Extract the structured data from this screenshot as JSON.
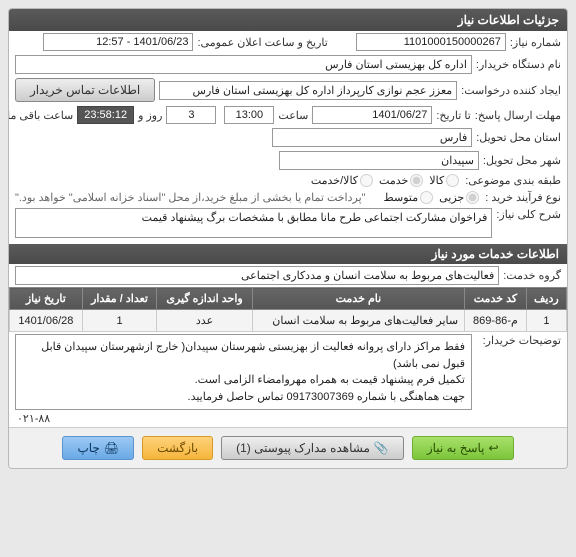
{
  "panel_title": "جزئیات اطلاعات نیاز",
  "fields": {
    "need_no_label": "شماره نیاز:",
    "need_no": "1101000150000267",
    "announce_dt_label": "تاریخ و ساعت اعلان عمومی:",
    "announce_dt": "1401/06/23 - 12:57",
    "buyer_label": "نام دستگاه خریدار:",
    "buyer": "اداره کل بهزیستی استان فارس",
    "creator_label": "ایجاد کننده درخواست:",
    "creator": "معزز عجم نوازی کارپرداز اداره کل بهزیستی استان فارس",
    "contact_btn": "اطلاعات تماس خریدار",
    "deadline_label1": "مهلت ارسال پاسخ:",
    "deadline_label2": "تا تاریخ:",
    "deadline_date": "1401/06/27",
    "saat": "ساعت",
    "deadline_time": "13:00",
    "rooz_va": "روز و",
    "remain_days": "3",
    "remain_time": "23:58:12",
    "remain_suffix": "ساعت باقی مانده",
    "province_label": "استان محل تحویل:",
    "province": "فارس",
    "city_label": "شهر محل تحویل:",
    "city": "سپیدان",
    "class_label": "طبقه بندی موضوعی:",
    "class_opts": {
      "kala": "کالا",
      "khadmat": "خدمت",
      "both": "کالا/خدمت"
    },
    "buytype_label": "نوع فرآیند خرید :",
    "buytype_opts": {
      "jozi": "جزیی",
      "motevaset": "متوسط"
    },
    "buytype_note": "\"پرداخت تمام یا بخشی از مبلغ خرید،از محل \"اسناد خزانه اسلامی\" خواهد بود.\"",
    "general_desc_label": "شرح کلی نیاز:",
    "general_desc": "فراخوان مشارکت اجتماعی طرح مانا مطابق با مشخصات برگ پیشنهاد قیمت",
    "services_title": "اطلاعات خدمات مورد نیاز",
    "group_label": "گروه خدمت:",
    "group": "فعالیت‌های مربوط به سلامت انسان و مددکاری اجتماعی",
    "buyer_notes_label": "توضیحات خریدار:",
    "buyer_notes": [
      "فقط مراکز دارای پروانه فعالیت از بهزیستی شهرستان سپیدان( خارج ازشهرستان  سپیدان  قابل قبول نمی باشد)",
      "تکمیل فرم پیشنهاد قیمت به همراه مهروامضاء الزامی است.",
      "جهت هماهنگی با شماره 09173007369 تماس حاصل فرمایید."
    ],
    "phone_tail": "۰۲۱-۸۸"
  },
  "table": {
    "headers": [
      "ردیف",
      "کد خدمت",
      "نام خدمت",
      "واحد اندازه گیری",
      "تعداد / مقدار",
      "تاریخ نیاز"
    ],
    "rows": [
      {
        "c": [
          "1",
          "م-86-869",
          "سایر فعالیت‌های مربوط به سلامت انسان",
          "عدد",
          "1",
          "1401/06/28"
        ]
      }
    ]
  },
  "buttons": {
    "reply": "پاسخ به نیاز",
    "attach": "مشاهده مدارک پیوستی (1)",
    "back": "بازگشت",
    "print": "چاپ"
  }
}
